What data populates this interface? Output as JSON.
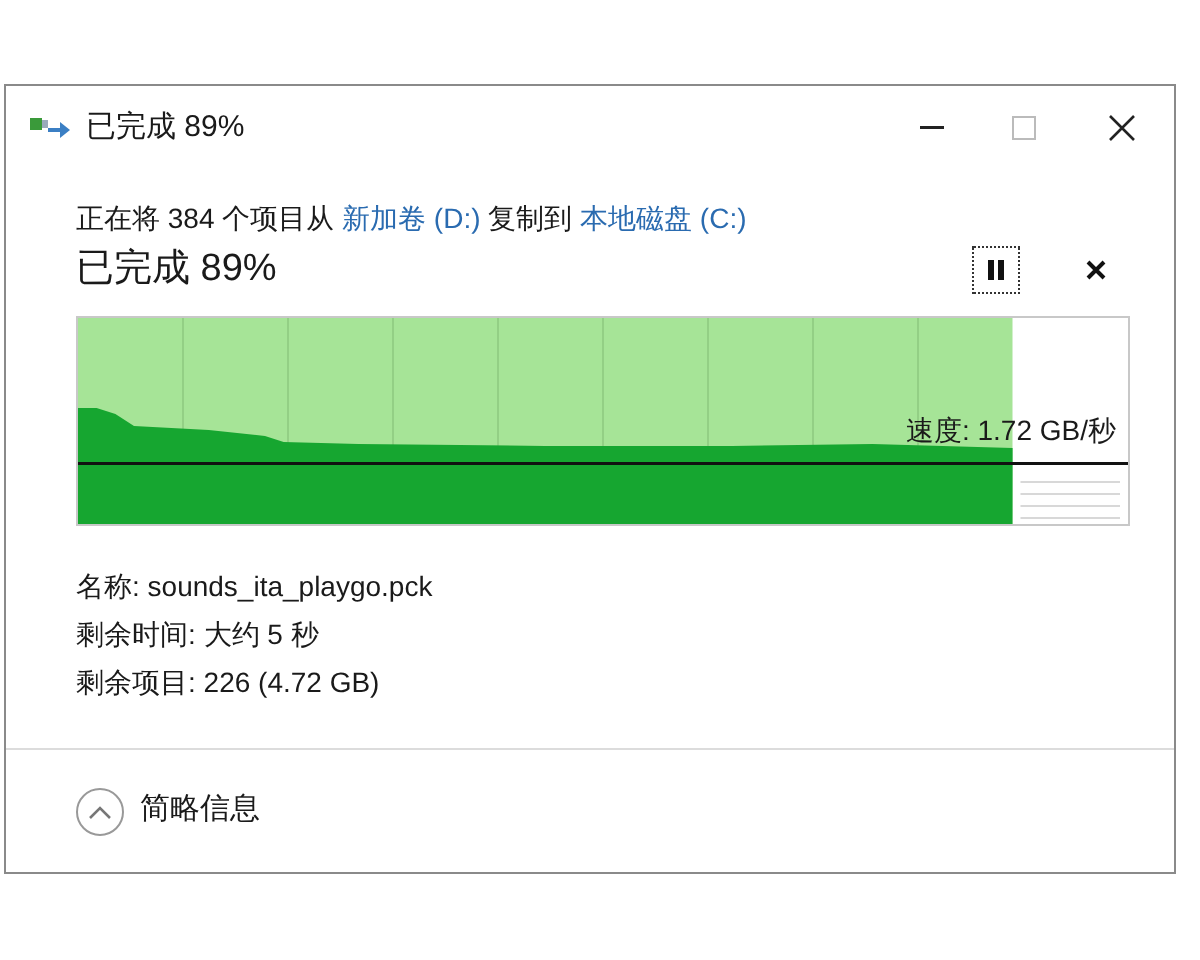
{
  "window": {
    "title": "已完成 89%"
  },
  "description": {
    "prefix": "正在将 384 个项目从 ",
    "source": "新加卷 (D:)",
    "middle": " 复制到 ",
    "destination": "本地磁盘 (C:)"
  },
  "progress": {
    "heading": "已完成 89%",
    "level": 0.89,
    "speed": "速度: 1.72 GB/秒"
  },
  "details": [
    {
      "label": "名称:",
      "value": "sounds_ita_playgo.pck"
    },
    {
      "label": "剩余时间:",
      "value": "大约 5 秒"
    },
    {
      "label": "剩余项目:",
      "value": "226 (4.72 GB)"
    }
  ],
  "footer": {
    "toggle": "简略信息"
  }
}
